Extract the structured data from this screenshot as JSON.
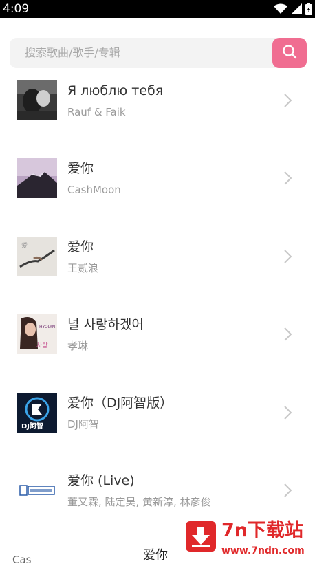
{
  "status_bar": {
    "time": "4:09"
  },
  "search": {
    "placeholder": "搜索歌曲/歌手/专辑"
  },
  "songs": [
    {
      "title": "Я люблю тебя",
      "artist": "Rauf & Faik"
    },
    {
      "title": "爱你",
      "artist": "CashMoon"
    },
    {
      "title": "爱你",
      "artist": "王贰浪"
    },
    {
      "title": "널 사랑하겠어",
      "artist": "孝琳"
    },
    {
      "title": "爱你（DJ阿智版）",
      "artist": "DJ阿智"
    },
    {
      "title": "爱你 (Live)",
      "artist": "董又霖, 陆定昊, 黄新淳, 林彦俊"
    }
  ],
  "bottom_partial": {
    "left_text": "Cas",
    "center_text": "爱你"
  },
  "watermark": {
    "title": "7n下载站",
    "url": "www.7ndn.com"
  },
  "colors": {
    "accent": "#f06d91",
    "watermark_red": "#e0282a"
  }
}
